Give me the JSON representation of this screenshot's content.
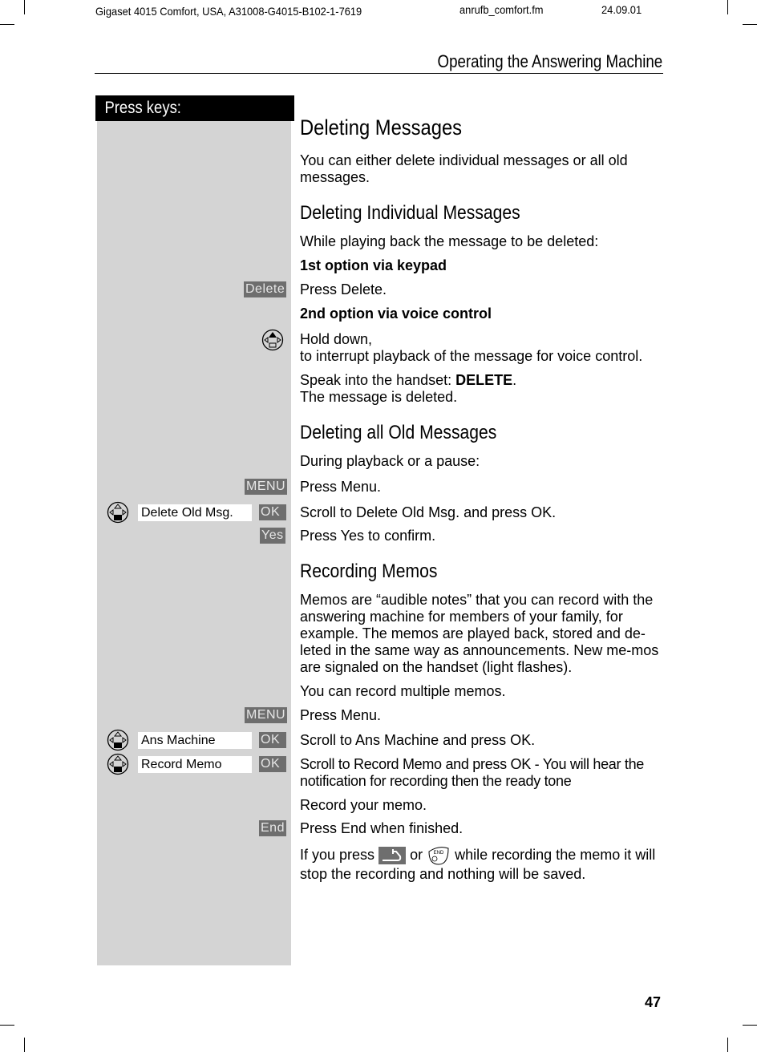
{
  "header": {
    "doc_info": "Gigaset 4015 Comfort, USA, A31008-G4015-B102-1-7619",
    "file_name": "anrufb_comfort.fm",
    "date": "24.09.01",
    "section_title": "Operating the Answering Machine"
  },
  "key_column_label": "Press keys:",
  "content": {
    "title": "Deleting Messages",
    "intro": "You can either delete individual messages or all old messages.",
    "individual": {
      "heading": "Deleting Individual Messages",
      "while_playing": "While playing back the message to be deleted:",
      "option1": "1st option via keypad",
      "press_delete": "Press Delete.",
      "option2": "2nd option via voice control",
      "hold_down": "Hold down,",
      "interrupt": "to interrupt playback of the message for voice control.",
      "speak_prefix": "Speak into the handset: ",
      "speak_cmd": "DELETE",
      "speak_suffix": ".",
      "deleted": "The message is deleted."
    },
    "all_old": {
      "heading": "Deleting all Old Messages",
      "during": "During playback or a pause:",
      "press_menu": "Press Menu.",
      "scroll_delete": "Scroll to Delete Old Msg. and press OK.",
      "press_yes": "Press Yes to confirm."
    },
    "memos": {
      "heading": "Recording Memos",
      "desc": "Memos are “audible notes” that you can record with the answering machine for members of your family, for example. The memos are played back, stored and de-leted in the same way as announcements. New me-mos are signaled on the handset (light flashes).",
      "multiple": "You can record multiple memos.",
      "press_menu": "Press Menu.",
      "scroll_ans": "Scroll to Ans Machine and press OK.",
      "scroll_record": "Scroll to Record Memo and press OK - You will hear the notification for recording then the ready tone",
      "record": "Record your memo.",
      "press_end": "Press End when finished.",
      "if_press": "If you press",
      "or": "or",
      "while_recording": "while recording the memo it will stop the recording and nothing will be saved."
    }
  },
  "keys": {
    "delete": "Delete",
    "menu": "MENU",
    "ok": "OK",
    "yes": "Yes",
    "end": "End",
    "end_key_label": "END"
  },
  "displays": {
    "delete_old": "Delete Old Msg.",
    "ans_machine": "Ans Machine",
    "record_memo": "Record Memo"
  },
  "page_number": "47"
}
